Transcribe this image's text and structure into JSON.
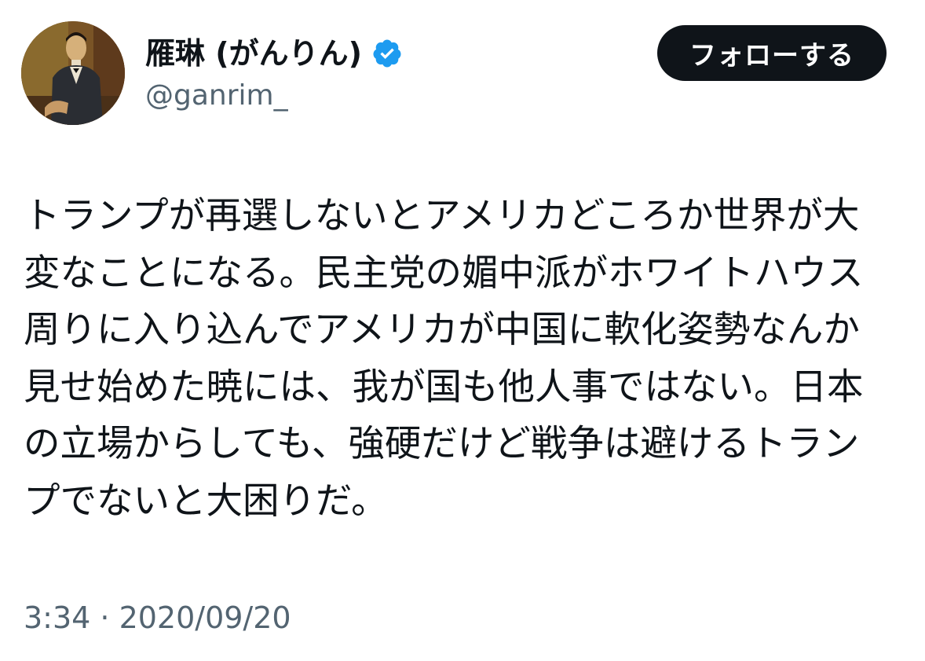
{
  "author": {
    "display_name": "雁琳 (がんりん)",
    "handle": "@ganrim_",
    "verified": true,
    "avatar_icon": "portrait-painting-avatar"
  },
  "follow_button": {
    "label": "フォローする"
  },
  "tweet": {
    "lines": [
      "トランプが再選しないとアメリカどころか世界が大",
      "変なことになる。民主党の媚中派がホワイトハウス",
      "周りに入り込んでアメリカが中国に軟化姿勢なんか",
      "見せ始めた暁には、我が国も他人事ではない。日本",
      "の立場からしても、強硬だけど戦争は避けるトラン",
      "プでないと大困りだ。"
    ]
  },
  "timestamp": "3:34 · 2020/09/20",
  "colors": {
    "text_primary": "#0f1419",
    "text_secondary": "#536471",
    "verified_badge": "#1d9bf0",
    "button_bg": "#0f1419",
    "button_text": "#ffffff"
  }
}
